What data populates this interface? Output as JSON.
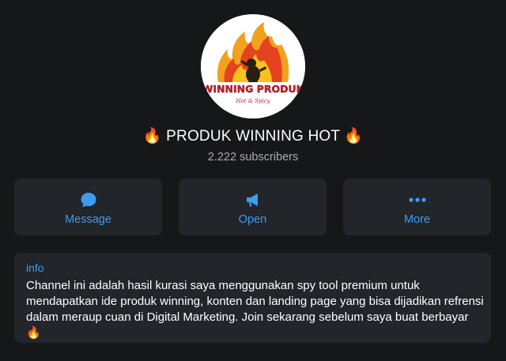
{
  "channel": {
    "title": "🔥 PRODUK WINNING HOT 🔥",
    "subscribers": "2.222 subscribers",
    "avatar": {
      "logo_line1": "WINNING PRODUK",
      "logo_line2": "Hot & Spicy"
    }
  },
  "actions": [
    {
      "label": "Message",
      "icon": "chat-bubble-icon"
    },
    {
      "label": "Open",
      "icon": "megaphone-icon"
    },
    {
      "label": "More",
      "icon": "more-dots-icon"
    }
  ],
  "info": {
    "label": "info",
    "description": "Channel ini adalah hasil kurasi saya menggunakan spy tool premium untuk mendapatkan ide produk winning, konten dan landing page yang bisa dijadikan refrensi dalam meraup cuan di Digital Marketing. Join sekarang sebelum saya buat berbayar 🔥"
  },
  "colors": {
    "background": "#161719",
    "card": "#22252a",
    "accent": "#3d9cf0",
    "muted_text": "#a8aab0"
  }
}
